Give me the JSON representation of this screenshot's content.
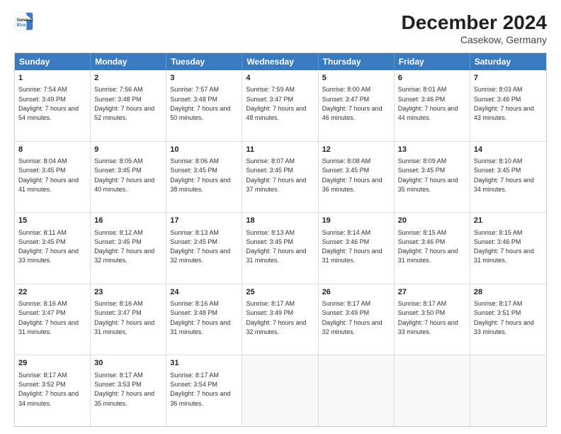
{
  "header": {
    "logo_line1": "General",
    "logo_line2": "Blue",
    "title": "December 2024",
    "subtitle": "Casekow, Germany"
  },
  "days_of_week": [
    "Sunday",
    "Monday",
    "Tuesday",
    "Wednesday",
    "Thursday",
    "Friday",
    "Saturday"
  ],
  "weeks": [
    [
      {
        "day": "1",
        "sunrise": "Sunrise: 7:54 AM",
        "sunset": "Sunset: 3:49 PM",
        "daylight": "Daylight: 7 hours and 54 minutes."
      },
      {
        "day": "2",
        "sunrise": "Sunrise: 7:56 AM",
        "sunset": "Sunset: 3:48 PM",
        "daylight": "Daylight: 7 hours and 52 minutes."
      },
      {
        "day": "3",
        "sunrise": "Sunrise: 7:57 AM",
        "sunset": "Sunset: 3:48 PM",
        "daylight": "Daylight: 7 hours and 50 minutes."
      },
      {
        "day": "4",
        "sunrise": "Sunrise: 7:59 AM",
        "sunset": "Sunset: 3:47 PM",
        "daylight": "Daylight: 7 hours and 48 minutes."
      },
      {
        "day": "5",
        "sunrise": "Sunrise: 8:00 AM",
        "sunset": "Sunset: 3:47 PM",
        "daylight": "Daylight: 7 hours and 46 minutes."
      },
      {
        "day": "6",
        "sunrise": "Sunrise: 8:01 AM",
        "sunset": "Sunset: 3:46 PM",
        "daylight": "Daylight: 7 hours and 44 minutes."
      },
      {
        "day": "7",
        "sunrise": "Sunrise: 8:03 AM",
        "sunset": "Sunset: 3:46 PM",
        "daylight": "Daylight: 7 hours and 43 minutes."
      }
    ],
    [
      {
        "day": "8",
        "sunrise": "Sunrise: 8:04 AM",
        "sunset": "Sunset: 3:45 PM",
        "daylight": "Daylight: 7 hours and 41 minutes."
      },
      {
        "day": "9",
        "sunrise": "Sunrise: 8:05 AM",
        "sunset": "Sunset: 3:45 PM",
        "daylight": "Daylight: 7 hours and 40 minutes."
      },
      {
        "day": "10",
        "sunrise": "Sunrise: 8:06 AM",
        "sunset": "Sunset: 3:45 PM",
        "daylight": "Daylight: 7 hours and 38 minutes."
      },
      {
        "day": "11",
        "sunrise": "Sunrise: 8:07 AM",
        "sunset": "Sunset: 3:45 PM",
        "daylight": "Daylight: 7 hours and 37 minutes."
      },
      {
        "day": "12",
        "sunrise": "Sunrise: 8:08 AM",
        "sunset": "Sunset: 3:45 PM",
        "daylight": "Daylight: 7 hours and 36 minutes."
      },
      {
        "day": "13",
        "sunrise": "Sunrise: 8:09 AM",
        "sunset": "Sunset: 3:45 PM",
        "daylight": "Daylight: 7 hours and 35 minutes."
      },
      {
        "day": "14",
        "sunrise": "Sunrise: 8:10 AM",
        "sunset": "Sunset: 3:45 PM",
        "daylight": "Daylight: 7 hours and 34 minutes."
      }
    ],
    [
      {
        "day": "15",
        "sunrise": "Sunrise: 8:11 AM",
        "sunset": "Sunset: 3:45 PM",
        "daylight": "Daylight: 7 hours and 33 minutes."
      },
      {
        "day": "16",
        "sunrise": "Sunrise: 8:12 AM",
        "sunset": "Sunset: 3:45 PM",
        "daylight": "Daylight: 7 hours and 32 minutes."
      },
      {
        "day": "17",
        "sunrise": "Sunrise: 8:13 AM",
        "sunset": "Sunset: 3:45 PM",
        "daylight": "Daylight: 7 hours and 32 minutes."
      },
      {
        "day": "18",
        "sunrise": "Sunrise: 8:13 AM",
        "sunset": "Sunset: 3:45 PM",
        "daylight": "Daylight: 7 hours and 31 minutes."
      },
      {
        "day": "19",
        "sunrise": "Sunrise: 8:14 AM",
        "sunset": "Sunset: 3:46 PM",
        "daylight": "Daylight: 7 hours and 31 minutes."
      },
      {
        "day": "20",
        "sunrise": "Sunrise: 8:15 AM",
        "sunset": "Sunset: 3:46 PM",
        "daylight": "Daylight: 7 hours and 31 minutes."
      },
      {
        "day": "21",
        "sunrise": "Sunrise: 8:15 AM",
        "sunset": "Sunset: 3:46 PM",
        "daylight": "Daylight: 7 hours and 31 minutes."
      }
    ],
    [
      {
        "day": "22",
        "sunrise": "Sunrise: 8:16 AM",
        "sunset": "Sunset: 3:47 PM",
        "daylight": "Daylight: 7 hours and 31 minutes."
      },
      {
        "day": "23",
        "sunrise": "Sunrise: 8:16 AM",
        "sunset": "Sunset: 3:47 PM",
        "daylight": "Daylight: 7 hours and 31 minutes."
      },
      {
        "day": "24",
        "sunrise": "Sunrise: 8:16 AM",
        "sunset": "Sunset: 3:48 PM",
        "daylight": "Daylight: 7 hours and 31 minutes."
      },
      {
        "day": "25",
        "sunrise": "Sunrise: 8:17 AM",
        "sunset": "Sunset: 3:49 PM",
        "daylight": "Daylight: 7 hours and 32 minutes."
      },
      {
        "day": "26",
        "sunrise": "Sunrise: 8:17 AM",
        "sunset": "Sunset: 3:49 PM",
        "daylight": "Daylight: 7 hours and 32 minutes."
      },
      {
        "day": "27",
        "sunrise": "Sunrise: 8:17 AM",
        "sunset": "Sunset: 3:50 PM",
        "daylight": "Daylight: 7 hours and 33 minutes."
      },
      {
        "day": "28",
        "sunrise": "Sunrise: 8:17 AM",
        "sunset": "Sunset: 3:51 PM",
        "daylight": "Daylight: 7 hours and 33 minutes."
      }
    ],
    [
      {
        "day": "29",
        "sunrise": "Sunrise: 8:17 AM",
        "sunset": "Sunset: 3:52 PM",
        "daylight": "Daylight: 7 hours and 34 minutes."
      },
      {
        "day": "30",
        "sunrise": "Sunrise: 8:17 AM",
        "sunset": "Sunset: 3:53 PM",
        "daylight": "Daylight: 7 hours and 35 minutes."
      },
      {
        "day": "31",
        "sunrise": "Sunrise: 8:17 AM",
        "sunset": "Sunset: 3:54 PM",
        "daylight": "Daylight: 7 hours and 36 minutes."
      },
      null,
      null,
      null,
      null
    ]
  ]
}
